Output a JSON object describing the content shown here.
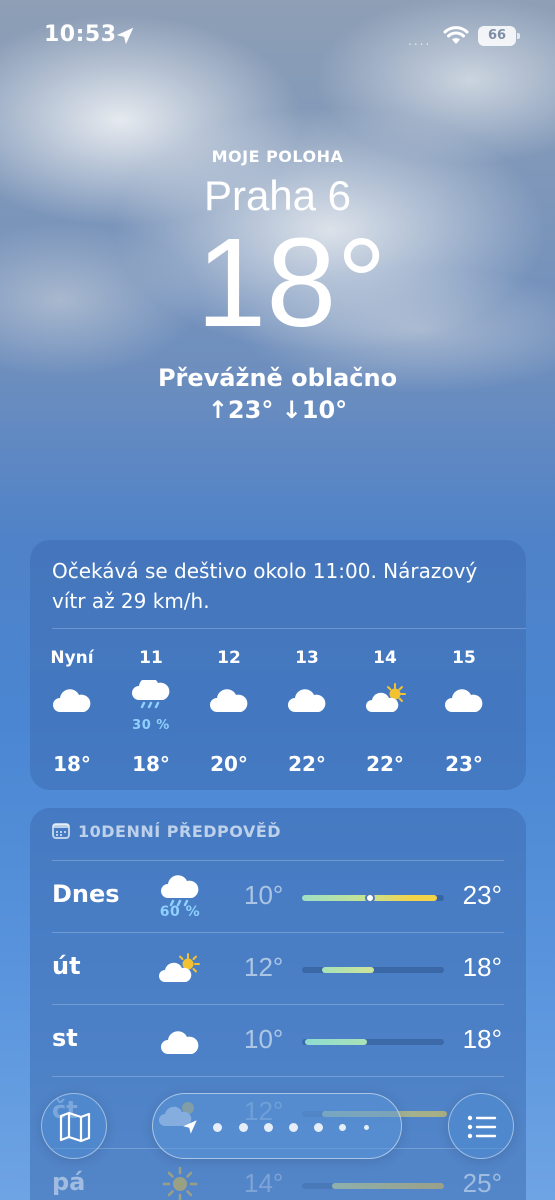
{
  "status_bar": {
    "time": "10:53",
    "signal": "....",
    "battery": "66"
  },
  "location": {
    "label": "MOJE POLOHA",
    "city": "Praha 6",
    "temperature": "18°",
    "condition": "Převážně oblačno",
    "high_low": "↑23°  ↓10°"
  },
  "hourly": {
    "summary": "Očekává se deštivo okolo 11:00. Nárazový vítr až 29 km/h.",
    "items": [
      {
        "label": "Nyní",
        "icon": "cloud-icon",
        "precip": "",
        "temp": "18°"
      },
      {
        "label": "11",
        "icon": "cloud-rain-icon",
        "precip": "30 %",
        "temp": "18°"
      },
      {
        "label": "12",
        "icon": "cloud-icon",
        "precip": "",
        "temp": "20°"
      },
      {
        "label": "13",
        "icon": "cloud-icon",
        "precip": "",
        "temp": "22°"
      },
      {
        "label": "14",
        "icon": "partly-sunny-icon",
        "precip": "",
        "temp": "22°"
      },
      {
        "label": "15",
        "icon": "cloud-icon",
        "precip": "",
        "temp": "23°"
      }
    ]
  },
  "daily": {
    "title": "10DENNÍ PŘEDPOVĚĎ",
    "items": [
      {
        "day": "Dnes",
        "icon": "cloud-rain-icon",
        "precip": "60 %",
        "low": "10°",
        "high": "23°"
      },
      {
        "day": "út",
        "icon": "partly-sunny-icon",
        "precip": "",
        "low": "12°",
        "high": "18°"
      },
      {
        "day": "st",
        "icon": "cloud-icon",
        "precip": "",
        "low": "10°",
        "high": "18°"
      },
      {
        "day": "čt",
        "icon": "partly-sunny-icon",
        "precip": "",
        "low": "12°",
        "high": ""
      },
      {
        "day": "pá",
        "icon": "sun-icon",
        "precip": "",
        "low": "14°",
        "high": "25°"
      }
    ]
  },
  "colors": {
    "precip_text": "#8fd0ff",
    "bar_cool": "#9fe0c4",
    "bar_warm": "#f2d34a"
  }
}
